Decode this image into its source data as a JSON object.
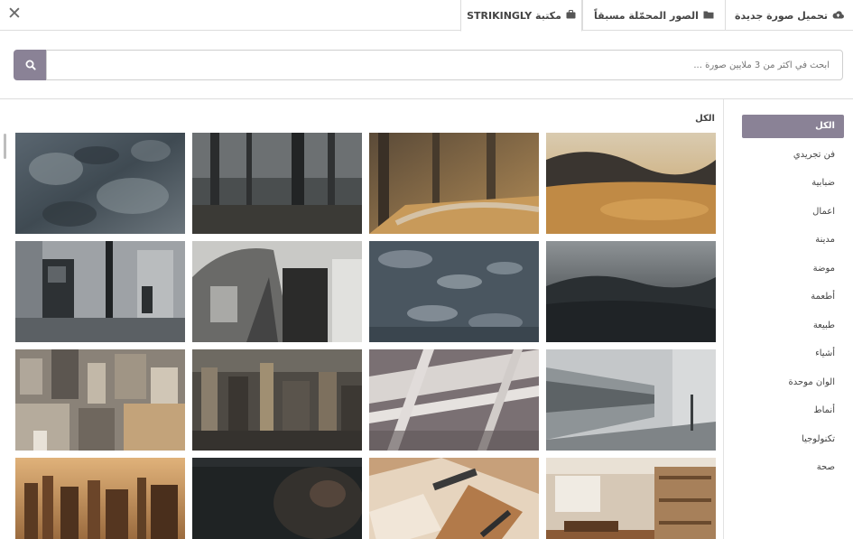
{
  "tabs": {
    "library_label": "مكتبة STRIKINGLY",
    "preloaded_label": "الصور المحمّلة مسبقاً",
    "upload_label": "تحميل صورة جديدة"
  },
  "search": {
    "placeholder": "ابحث في أكثر من 3 ملايين صورة ..."
  },
  "gallery": {
    "title": "الكل"
  },
  "categories": [
    {
      "label": "الكل",
      "active": true
    },
    {
      "label": "فن تجريدي"
    },
    {
      "label": "ضبابية"
    },
    {
      "label": "اعمال"
    },
    {
      "label": "مدينة"
    },
    {
      "label": "موضة"
    },
    {
      "label": "أطعمة"
    },
    {
      "label": "طبيعة"
    },
    {
      "label": "أشياء"
    },
    {
      "label": "الوان موحدة"
    },
    {
      "label": "أنماط"
    },
    {
      "label": "تكنولوجيا"
    },
    {
      "label": "صحة"
    }
  ],
  "colors": {
    "accent": "#8a8296"
  }
}
